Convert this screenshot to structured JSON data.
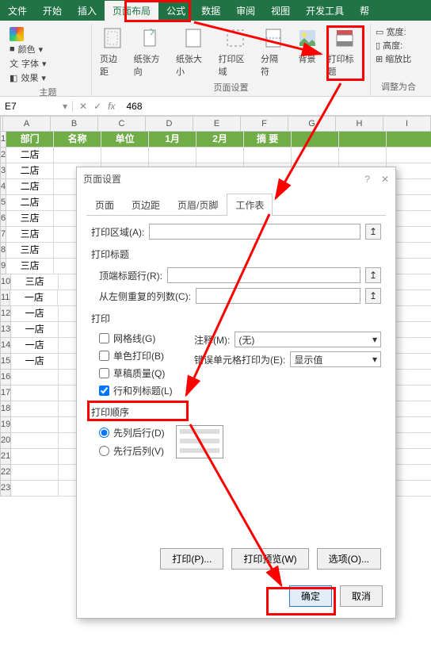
{
  "menu": {
    "tabs": [
      "文件",
      "开始",
      "插入",
      "页面布局",
      "公式",
      "数据",
      "审阅",
      "视图",
      "开发工具",
      "帮"
    ],
    "active": 3
  },
  "ribbon": {
    "theme": {
      "colors": "颜色",
      "fonts": "字体",
      "effects": "效果",
      "group": "主题"
    },
    "page_setup": {
      "margins": "页边距",
      "orientation": "纸张方向",
      "size": "纸张大小",
      "print_area": "打印区域",
      "breaks": "分隔符",
      "background": "背景",
      "print_titles": "打印标题",
      "group": "页面设置"
    },
    "scale": {
      "width": "宽度:",
      "height": "高度:",
      "scale": "缩放比",
      "group": "调整为合"
    }
  },
  "formula_bar": {
    "name_box": "E7",
    "fx": "fx",
    "value": "468"
  },
  "grid": {
    "cols": [
      "A",
      "B",
      "C",
      "D",
      "E",
      "F",
      "G",
      "H",
      "I"
    ],
    "rows": 23,
    "header_row": [
      "部门",
      "名称",
      "单位",
      "1月",
      "2月",
      "摘  要",
      "",
      "",
      ""
    ],
    "dept_values": [
      "",
      "二店",
      "二店",
      "二店",
      "二店",
      "三店",
      "三店",
      "三店",
      "三店",
      "三店",
      "一店",
      "一店",
      "一店",
      "一店",
      "一店",
      "",
      "",
      "",
      "",
      "",
      "",
      "",
      ""
    ]
  },
  "dialog": {
    "title": "页面设置",
    "tabs": [
      "页面",
      "页边距",
      "页眉/页脚",
      "工作表"
    ],
    "active_tab": 3,
    "print_area_label": "打印区域(A):",
    "print_titles": "打印标题",
    "top_rows": "顶端标题行(R):",
    "left_cols": "从左侧重复的列数(C):",
    "print_section": "打印",
    "gridlines": "网格线(G)",
    "bw": "单色打印(B)",
    "draft": "草稿质量(Q)",
    "rowcol_headings": "行和列标题(L)",
    "comments": "注释(M):",
    "comments_val": "(无)",
    "errors": "错误单元格打印为(E):",
    "errors_val": "显示值",
    "order_section": "打印顺序",
    "order_down": "先列后行(D)",
    "order_over": "先行后列(V)",
    "btn_print": "打印(P)...",
    "btn_preview": "打印预览(W)",
    "btn_options": "选项(O)...",
    "btn_ok": "确定",
    "btn_cancel": "取消"
  }
}
